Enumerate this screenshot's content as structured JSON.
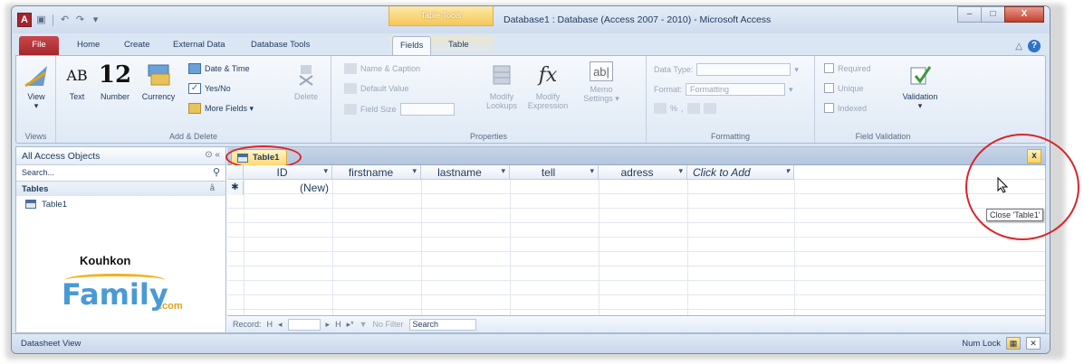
{
  "window": {
    "title": "Database1 : Database (Access 2007 - 2010) - Microsoft Access",
    "context_tools": "Table Tools",
    "controls": [
      "–",
      "□",
      "X"
    ]
  },
  "quick_access": {
    "logo": "A"
  },
  "tabs": [
    "File",
    "Home",
    "Create",
    "External Data",
    "Database Tools",
    "Fields",
    "Table"
  ],
  "active_tab": "Fields",
  "ribbon": {
    "views": {
      "label": "Views",
      "view": "View"
    },
    "add_delete": {
      "label": "Add & Delete",
      "text": "Text",
      "text_glyph": "AB",
      "number": "Number",
      "number_glyph": "12",
      "currency": "Currency",
      "date_time": "Date & Time",
      "yes_no": "Yes/No",
      "more_fields": "More Fields ▾",
      "delete": "Delete"
    },
    "properties": {
      "label": "Properties",
      "name_caption": "Name & Caption",
      "default_value": "Default Value",
      "field_size": "Field Size",
      "modify_lookups": "Modify Lookups",
      "modify_expression": "Modify Expression",
      "memo_settings": "Memo Settings ▾",
      "fx_glyph": "fx",
      "ab_glyph": "ab|"
    },
    "formatting": {
      "label": "Formatting",
      "data_type": "Data Type:",
      "format": "Format:",
      "format_value": "Formatting",
      "percent": "%"
    },
    "validation": {
      "label": "Field Validation",
      "required": "Required",
      "unique": "Unique",
      "indexed": "Indexed",
      "validation": "Validation"
    }
  },
  "nav": {
    "header": "All Access Objects",
    "header_controls": "⊙  «",
    "search_placeholder": "Search...",
    "section": "Tables",
    "section_chevron": "å",
    "items": [
      "Table1"
    ]
  },
  "logo": {
    "top": "Kouhkon",
    "main": "Family",
    "suffix": ".com"
  },
  "document": {
    "tab": "Table1",
    "close": "x",
    "columns": [
      {
        "label": "ID",
        "width": 98
      },
      {
        "label": "firstname",
        "width": 98
      },
      {
        "label": "lastname",
        "width": 98
      },
      {
        "label": "tell",
        "width": 98
      },
      {
        "label": "adress",
        "width": 98
      },
      {
        "label": "Click to Add",
        "width": 118
      }
    ],
    "new_row": "(New)",
    "new_row_marker": "✱"
  },
  "record_bar": {
    "label": "Record:",
    "nav_first": "H",
    "nav_prev": "◂",
    "nav_next": "▸",
    "nav_last": "H",
    "nav_new": "▸*",
    "no_filter": "No Filter",
    "search": "Search"
  },
  "tooltip": "Close 'Table1'",
  "status": {
    "left": "Datasheet View",
    "num_lock": "Num Lock",
    "view_btns": [
      "▦",
      "✕"
    ]
  },
  "colors": {
    "accent": "#d9252a",
    "file_tab": "#a4262c",
    "ribbon": "#dfe9f5"
  }
}
